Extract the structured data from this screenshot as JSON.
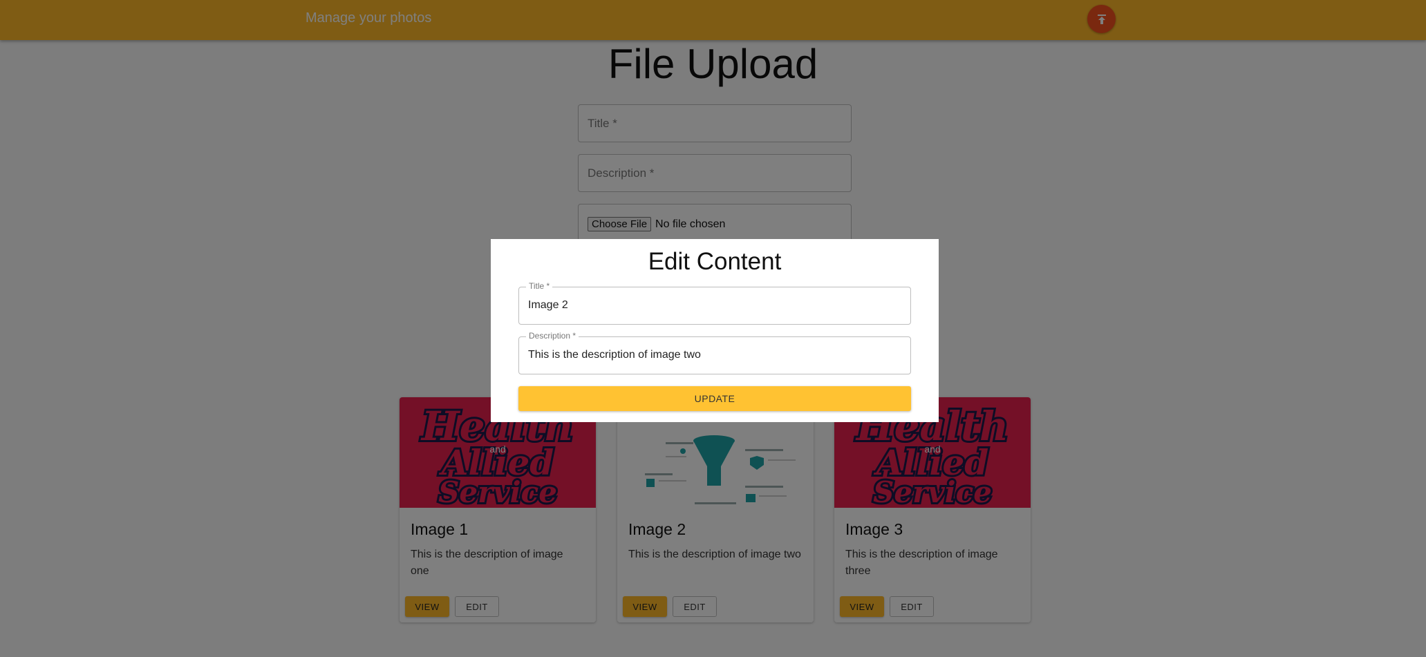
{
  "appbar": {
    "title": "Manage your photos",
    "upload_icon": "upload-icon"
  },
  "page": {
    "title": "File Upload"
  },
  "form": {
    "title_placeholder": "Title *",
    "description_placeholder": "Description *",
    "choose_file_label": "Choose File",
    "file_status": "No file chosen"
  },
  "cards": [
    {
      "title": "Image 1",
      "description": "This is the description of image one",
      "view_label": "VIEW",
      "edit_label": "EDIT",
      "image": "Health and Allied Service logo"
    },
    {
      "title": "Image 2",
      "description": "This is the description of image two",
      "view_label": "VIEW",
      "edit_label": "EDIT",
      "image": "infographic with funnel"
    },
    {
      "title": "Image 3",
      "description": "This is the description of image three",
      "view_label": "VIEW",
      "edit_label": "EDIT",
      "image": "Health and Allied Service logo"
    }
  ],
  "modal": {
    "title": "Edit Content",
    "title_label": "Title *",
    "title_value": "Image 2",
    "description_label": "Description *",
    "description_value": "This is the description of image two",
    "update_label": "UPDATE"
  },
  "colors": {
    "primary": "#ffb929",
    "accent": "#f4511e",
    "card_media": "#e8204f"
  }
}
